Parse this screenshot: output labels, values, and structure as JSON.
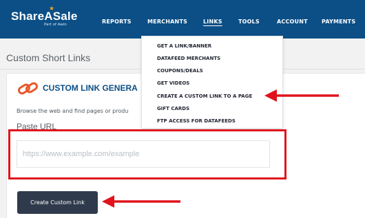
{
  "header": {
    "logo_text": "ShareASale",
    "logo_subtext": "Part of Awin",
    "nav": [
      {
        "label": "REPORTS"
      },
      {
        "label": "MERCHANTS"
      },
      {
        "label": "LINKS"
      },
      {
        "label": "TOOLS"
      },
      {
        "label": "ACCOUNT"
      },
      {
        "label": "PAYMENTS"
      }
    ],
    "active_nav": "LINKS"
  },
  "dropdown": {
    "items": [
      {
        "label": "GET A LINK/BANNER"
      },
      {
        "label": "DATAFEED MERCHANTS"
      },
      {
        "label": "COUPONS/DEALS"
      },
      {
        "label": "GET VIDEOS"
      },
      {
        "label": "CREATE A CUSTOM LINK TO A PAGE"
      },
      {
        "label": "GIFT CARDS"
      },
      {
        "label": "FTP ACCESS FOR DATAFEEDS"
      }
    ]
  },
  "page": {
    "title": "Custom Short Links"
  },
  "card": {
    "title": "CUSTOM LINK GENERA",
    "description": "Browse the web and find pages or produ",
    "paste_label": "Paste URL",
    "input_value": "",
    "input_placeholder": "https://www.example.com/example",
    "button_label": "Create Custom Link"
  },
  "icons": {
    "link": "link-icon",
    "logo_star": "star-icon",
    "arrow": "arrow-left-icon"
  },
  "colors": {
    "nav_bg": "#0b4f86",
    "brand_star": "#f4a21d",
    "button_bg": "#2f3b4c",
    "link_icon": "#e8572a",
    "annotation_red": "#e0131b"
  }
}
